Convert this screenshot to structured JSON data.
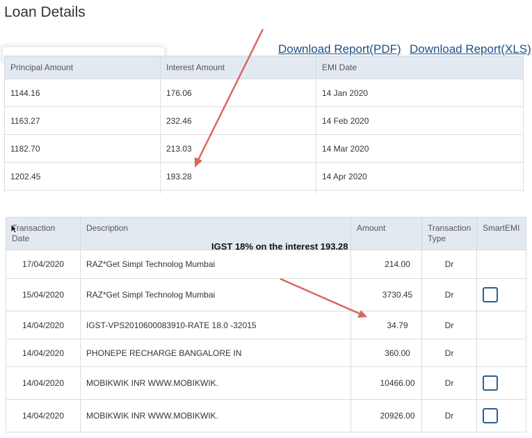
{
  "page": {
    "title": "Loan Details"
  },
  "links": {
    "download_pdf": "Download Report(PDF)",
    "download_xls": "Download Report(XLS)"
  },
  "loan_table": {
    "headers": [
      "Principal Amount",
      "Interest Amount",
      "EMI Date"
    ],
    "rows": [
      [
        "1144.16",
        "176.06",
        "14 Jan 2020"
      ],
      [
        "1163.27",
        "232.46",
        "14 Feb 2020"
      ],
      [
        "1182.70",
        "213.03",
        "14 Mar 2020"
      ],
      [
        "1202.45",
        "193.28",
        "14 Apr 2020"
      ]
    ]
  },
  "annotation": {
    "text": "IGST 18% on the interest 193.28"
  },
  "txn_table": {
    "headers": [
      "Transaction Date",
      "Description",
      "Amount",
      "Transaction Type",
      "SmartEMI"
    ],
    "rows": [
      {
        "date": "17/04/2020",
        "description": "RAZ*Get Simpl Technolog Mumbai",
        "amount": "214.00",
        "type": "Dr",
        "smartemi": false
      },
      {
        "date": "15/04/2020",
        "description": "RAZ*Get Simpl Technolog Mumbai",
        "amount": "3730.45",
        "type": "Dr",
        "smartemi": true
      },
      {
        "date": "14/04/2020",
        "description": "IGST-VPS2010600083910-RATE 18.0 -32015",
        "amount": "34.79",
        "type": "Dr",
        "smartemi": false
      },
      {
        "date": "14/04/2020",
        "description": "PHONEPE RECHARGE BANGALORE IN",
        "amount": "360.00",
        "type": "Dr",
        "smartemi": false
      },
      {
        "date": "14/04/2020",
        "description": "MOBIKWIK INR WWW.MOBIKWIK.",
        "amount": "10466.00",
        "type": "Dr",
        "smartemi": true
      },
      {
        "date": "14/04/2020",
        "description": "MOBIKWIK INR WWW.MOBIKWIK.",
        "amount": "20926.00",
        "type": "Dr",
        "smartemi": true
      }
    ]
  },
  "colors": {
    "header_bg": "#e3e9f1",
    "link": "#1d4f86",
    "arrow": "#d9685a",
    "checkbox": "#2d5f8f"
  }
}
